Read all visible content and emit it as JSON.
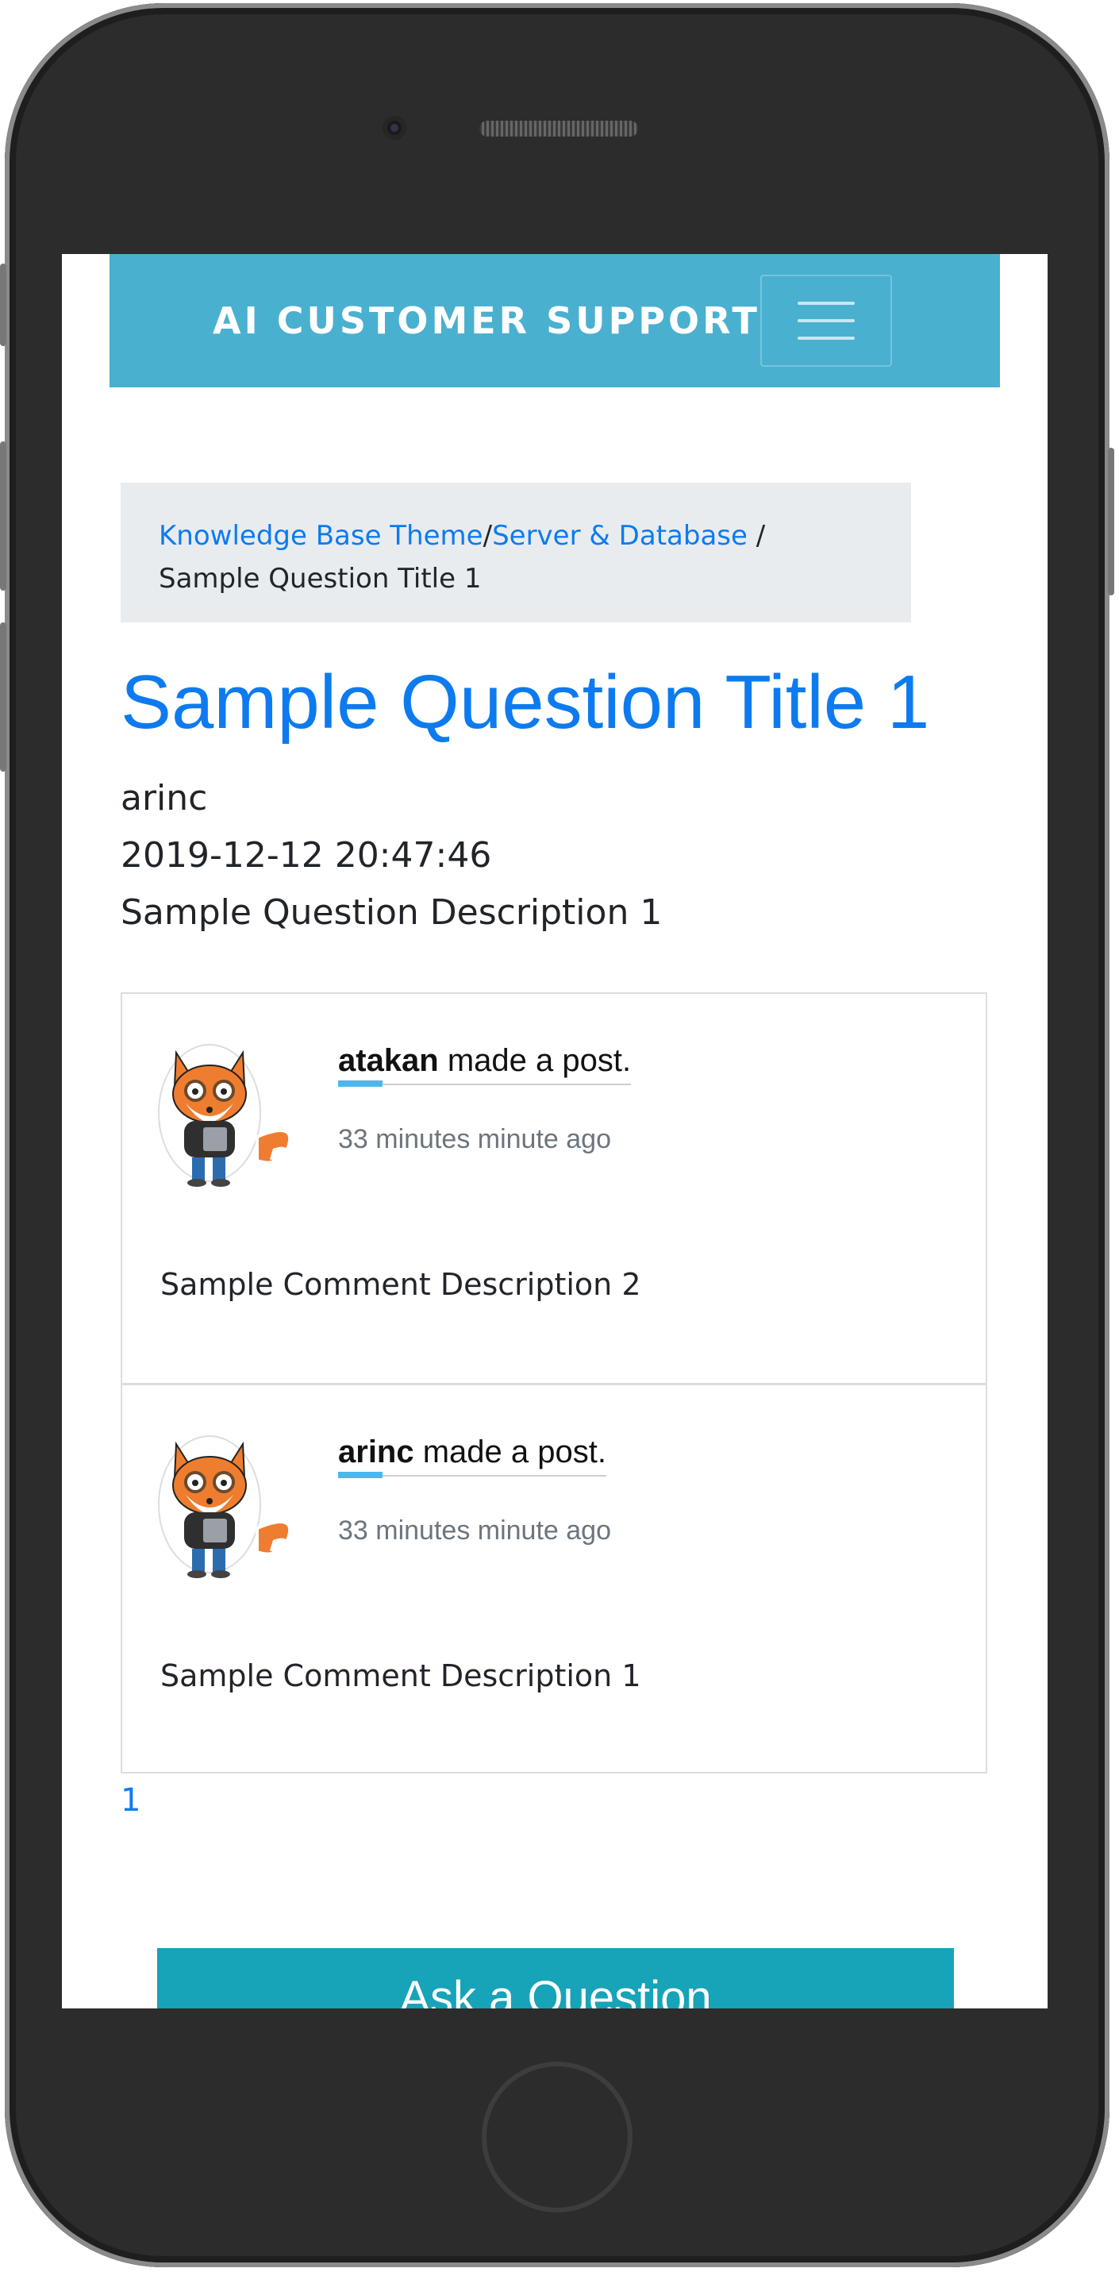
{
  "header": {
    "brand": "AI CUSTOMER SUPPORT",
    "menu_icon": "hamburger-menu-icon"
  },
  "breadcrumb": {
    "items": [
      {
        "label": "Knowledge Base Theme",
        "link": true
      },
      {
        "label": "Server & Database",
        "link": true
      },
      {
        "label": "Sample Question Title 1",
        "link": false
      }
    ],
    "separator": "/"
  },
  "question": {
    "title": "Sample Question Title 1",
    "author": "arinc",
    "date": "2019-12-12 20:47:46",
    "description": "Sample Question Description 1"
  },
  "comments": [
    {
      "user": "atakan",
      "action": " made a post.",
      "time": "33 minutes minute ago",
      "text": "Sample Comment Description 2",
      "avatar_icon": "fox-avatar-icon"
    },
    {
      "user": "arinc",
      "action": " made a post.",
      "time": "33 minutes minute ago",
      "text": "Sample Comment Description 1",
      "avatar_icon": "fox-avatar-icon"
    }
  ],
  "pagination": {
    "current_page": "1"
  },
  "ask_button": {
    "label": "Ask a Question"
  },
  "colors": {
    "navbar": "#4ab0d0",
    "link": "#0d7bef",
    "breadcrumb_bg": "#e9ecef",
    "ask_button": "#17a3b8",
    "accent_bar": "#4fb6ea"
  }
}
